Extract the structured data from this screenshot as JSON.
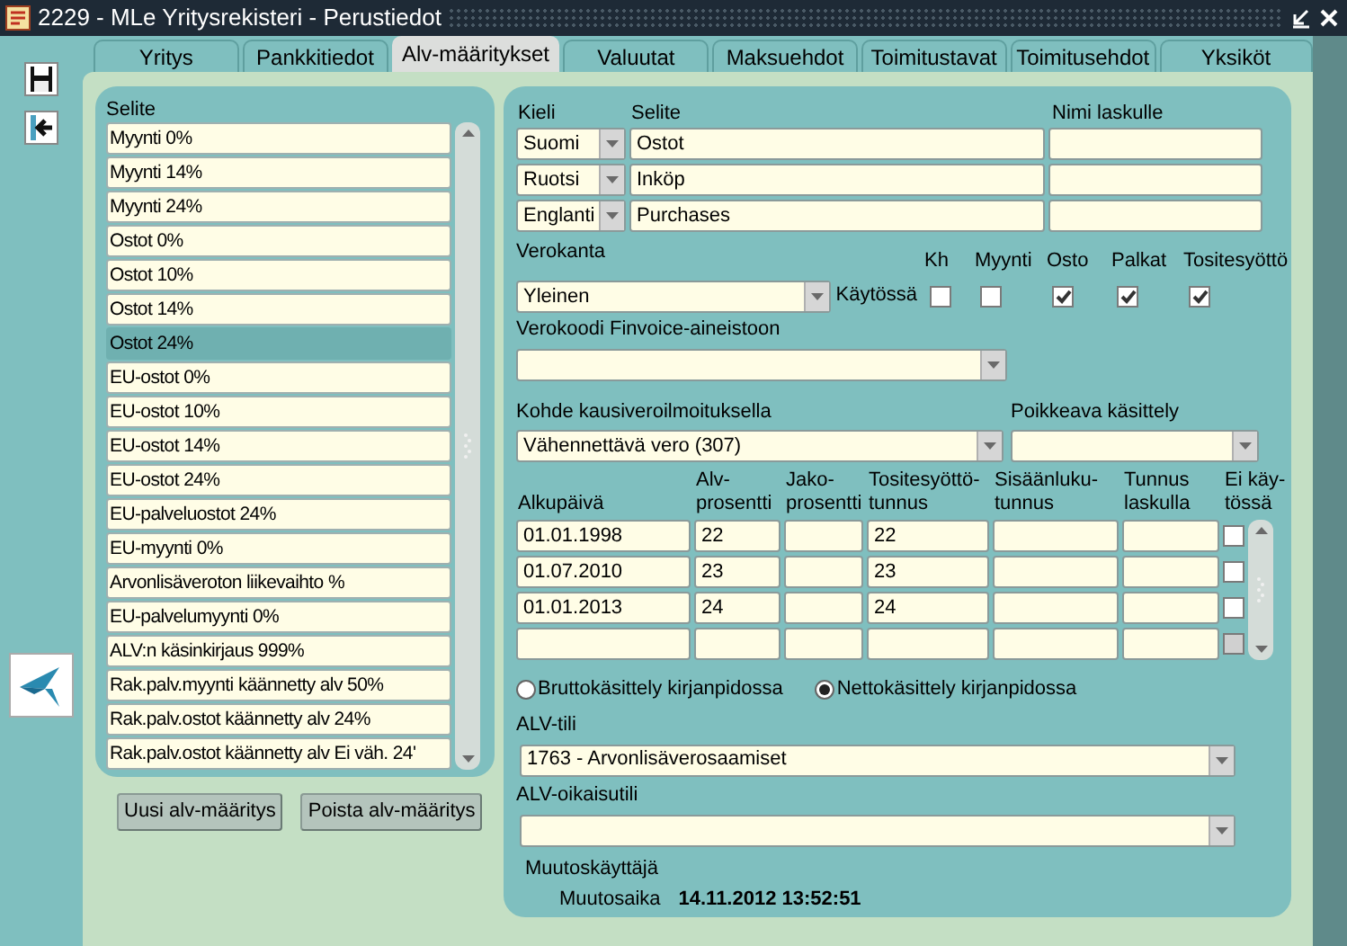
{
  "window": {
    "title": "2229 - MLe Yritysrekisteri - Perustiedot"
  },
  "tabs": [
    {
      "label": "Yritys",
      "selected": false
    },
    {
      "label": "Pankkitiedot",
      "selected": false
    },
    {
      "label": "Alv-määritykset",
      "selected": true
    },
    {
      "label": "Valuutat",
      "selected": false
    },
    {
      "label": "Maksuehdot",
      "selected": false
    },
    {
      "label": "Toimitustavat",
      "selected": false
    },
    {
      "label": "Toimitusehdot",
      "selected": false
    },
    {
      "label": "Yksiköt",
      "selected": false
    }
  ],
  "vat_list": {
    "header": "Selite",
    "items": [
      {
        "label": "Myynti 0%",
        "selected": false
      },
      {
        "label": "Myynti 14%",
        "selected": false
      },
      {
        "label": "Myynti 24%",
        "selected": false
      },
      {
        "label": "Ostot 0%",
        "selected": false
      },
      {
        "label": "Ostot 10%",
        "selected": false
      },
      {
        "label": "Ostot 14%",
        "selected": false
      },
      {
        "label": "Ostot 24%",
        "selected": true
      },
      {
        "label": "EU-ostot 0%",
        "selected": false
      },
      {
        "label": "EU-ostot 10%",
        "selected": false
      },
      {
        "label": "EU-ostot 14%",
        "selected": false
      },
      {
        "label": "EU-ostot 24%",
        "selected": false
      },
      {
        "label": "EU-palveluostot 24%",
        "selected": false
      },
      {
        "label": "EU-myynti 0%",
        "selected": false
      },
      {
        "label": "Arvonlisäveroton liikevaihto %",
        "selected": false
      },
      {
        "label": "EU-palvelumyynti 0%",
        "selected": false
      },
      {
        "label": "ALV:n käsinkirjaus 999%",
        "selected": false
      },
      {
        "label": "Rak.palv.myynti käännetty alv 50%",
        "selected": false
      },
      {
        "label": "Rak.palv.ostot käännetty alv 24%",
        "selected": false
      },
      {
        "label": "Rak.palv.ostot käännetty alv Ei väh. 24'",
        "selected": false
      }
    ]
  },
  "buttons": [
    "Uusi alv-määritys",
    "Poista alv-määritys"
  ],
  "names": {
    "columns": [
      "Kieli",
      "Selite",
      "Nimi laskulle"
    ],
    "rows": [
      {
        "language": "Suomi",
        "description": "Ostot"
      },
      {
        "language": "Ruotsi",
        "description": "Inköp"
      },
      {
        "language": "Englanti",
        "description": "Purchases"
      }
    ]
  },
  "verokanta": {
    "label": "Verokanta",
    "value": "Yleinen"
  },
  "usage": {
    "label": "Käytössä",
    "flags": [
      {
        "label": "Kh",
        "checked": false
      },
      {
        "label": "Myynti",
        "checked": false
      },
      {
        "label": "Osto",
        "checked": true
      },
      {
        "label": "Palkat",
        "checked": true
      },
      {
        "label": "Tositesyöttö",
        "checked": true
      }
    ]
  },
  "verokoodi": {
    "label": "Verokoodi Finvoice-aineistoon"
  },
  "kohde": {
    "label": "Kohde kausiveroilmoituksella",
    "value": "Vähennettävä vero (307)"
  },
  "poikkeava": {
    "label": "Poikkeava käsittely"
  },
  "rates": {
    "columns": [
      "Alkupäivä",
      "Alv-prosentti",
      "Jako-prosentti",
      "Tositesyöttö-tunnus",
      "Sisäänluku-tunnus",
      "Tunnus laskulla",
      "Ei käy-tössä"
    ],
    "rows": [
      {
        "start": "01.01.1998",
        "vat": "22",
        "code": "22",
        "unused": false,
        "disabled": false
      },
      {
        "start": "01.07.2010",
        "vat": "23",
        "code": "23",
        "unused": false,
        "disabled": false
      },
      {
        "start": "01.01.2013",
        "vat": "24",
        "code": "24",
        "unused": false,
        "disabled": false
      },
      {
        "unused": false,
        "disabled": true
      }
    ]
  },
  "treatment": [
    {
      "label": "Bruttokäsittely kirjanpidossa",
      "selected": false
    },
    {
      "label": "Nettokäsittely kirjanpidossa",
      "selected": true
    }
  ],
  "alv_tili": {
    "label": "ALV-tili",
    "value": "1763 - Arvonlisäverosaamiset"
  },
  "oikaisutili": {
    "label": "ALV-oikaisutili"
  },
  "modified_by": {
    "label": "Muutoskäyttäjä"
  },
  "modified_at": {
    "label": "Muutosaika",
    "value": "14.11.2012 13:52:51"
  }
}
